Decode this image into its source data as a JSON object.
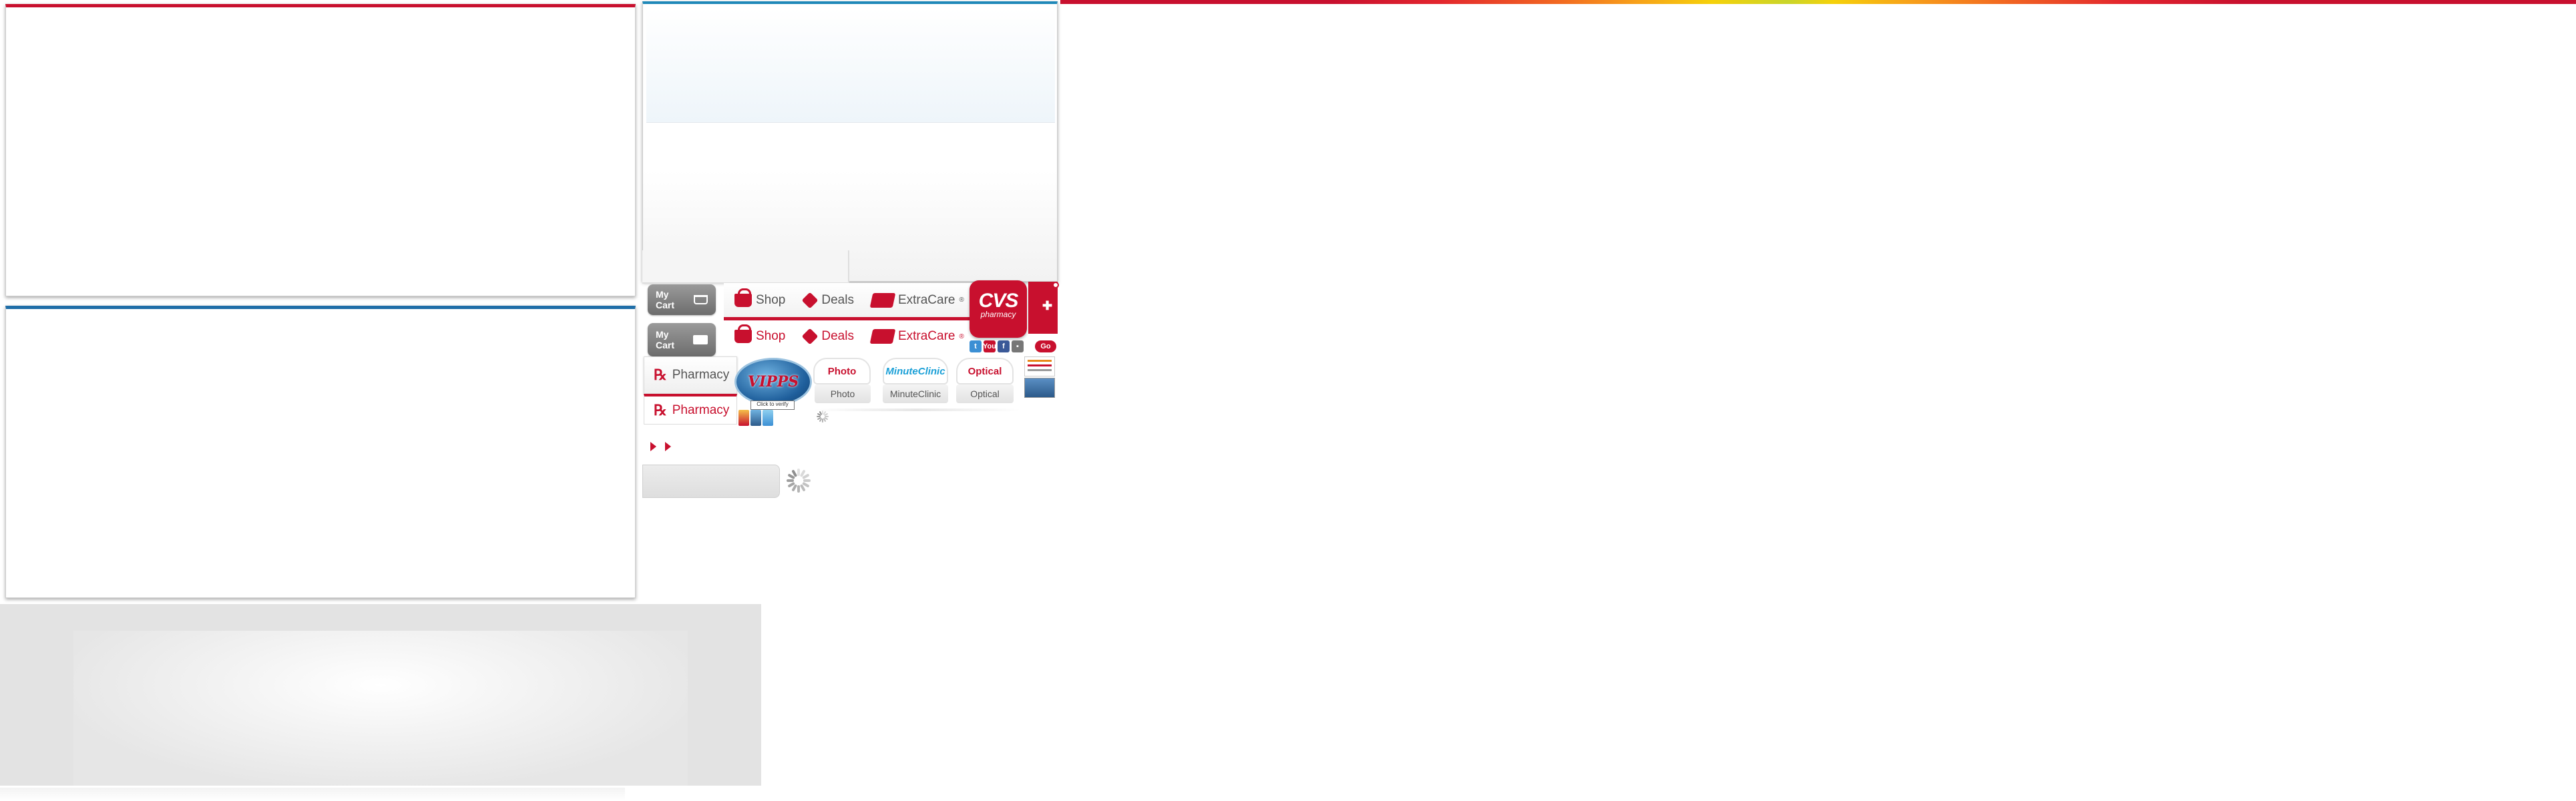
{
  "nav": {
    "cart_label": "My Cart",
    "shop": "Shop",
    "deals": "Deals",
    "extracare": "ExtraCare",
    "registered": "®",
    "pharmacy": "Pharmacy"
  },
  "brand": {
    "logo_text": "CVS",
    "logo_sub": "pharmacy",
    "primary_color": "#c8102e",
    "accent_blue": "#1f88b8"
  },
  "search": {
    "go_label": "Go"
  },
  "social": [
    "t",
    "You",
    "f",
    "▪"
  ],
  "vipps": {
    "logo_text": "VIPPS",
    "label": "Click to verify"
  },
  "service_tabs": [
    {
      "label": "Photo"
    },
    {
      "label": "MinuteClinic"
    },
    {
      "label": "Optical"
    }
  ],
  "icons": [
    "basket-icon",
    "tag-icon",
    "card-icon",
    "rx-icon",
    "cart-icon",
    "spinner-icon",
    "arrow-right-icon"
  ]
}
